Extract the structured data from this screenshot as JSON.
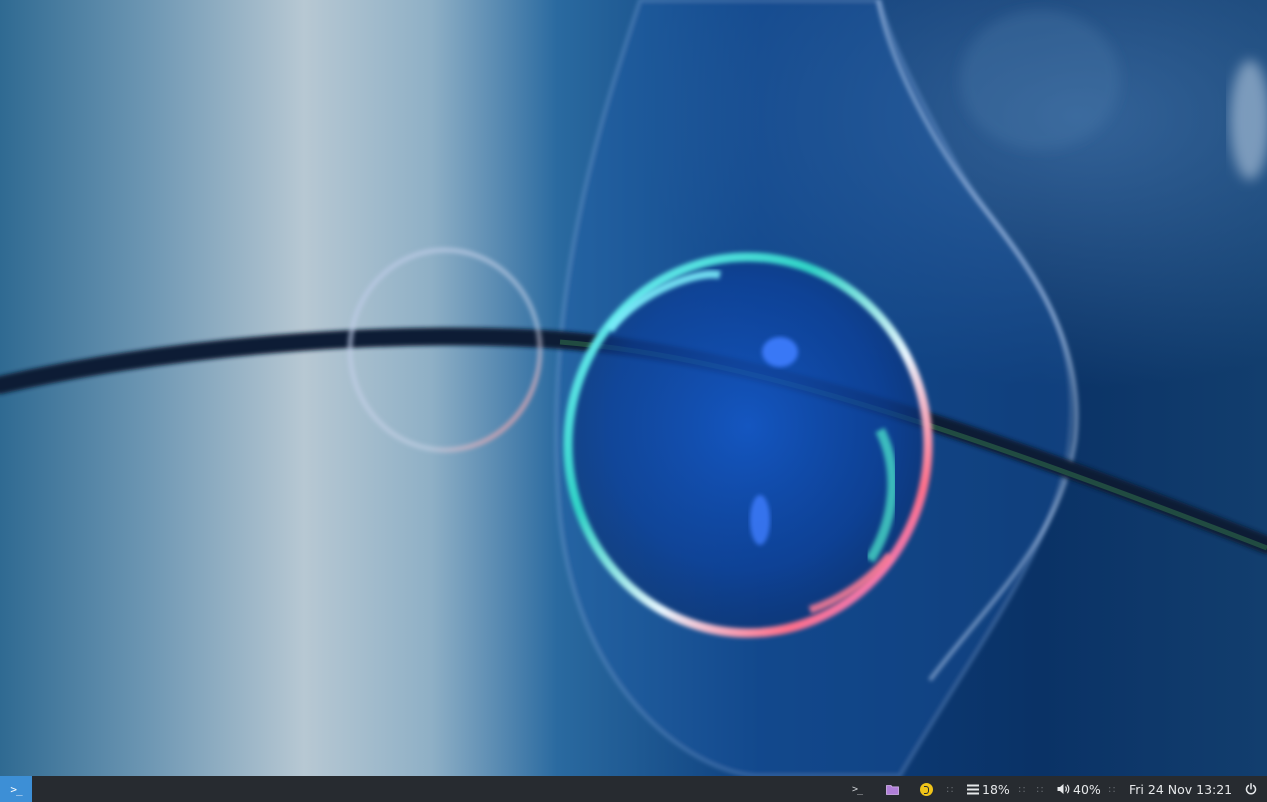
{
  "desktop": {
    "wallpaper": "abstract-glass-bubble-wallpaper",
    "colors": {
      "deep_blue": "#0e3f86",
      "navy": "#07224a",
      "pale_blue": "#a9c1d0",
      "taskbar": "#272b30",
      "launcher_accent": "#3d8fd6"
    }
  },
  "taskbar": {
    "launcher_glyph": ">_",
    "tray": {
      "terminal_glyph": ">_",
      "cpu_usage": "18%",
      "volume": "40%",
      "clock": "Fri 24 Nov 13:21",
      "separator": "::"
    },
    "icons": [
      "terminal-icon",
      "folder-icon",
      "update-notifier-icon",
      "cpu-icon",
      "volume-icon",
      "power-icon"
    ]
  }
}
